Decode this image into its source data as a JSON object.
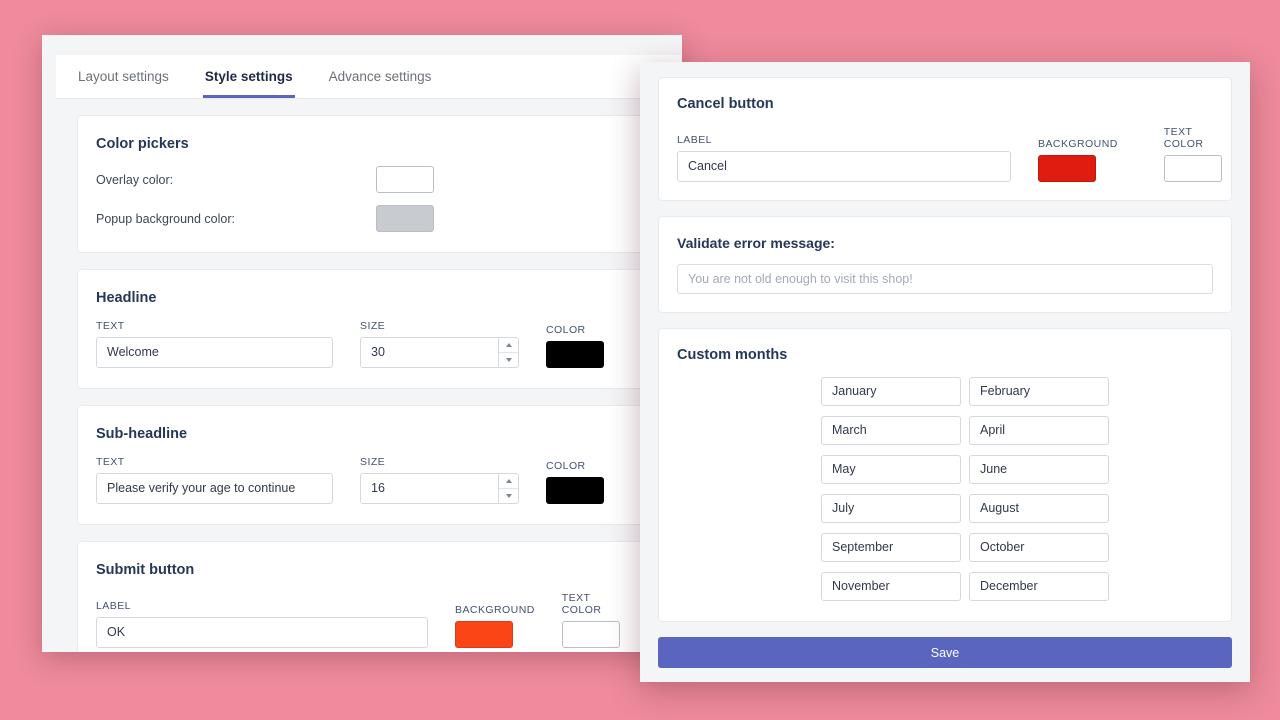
{
  "theme": {
    "page_background": "#ef8b9c",
    "accent": "#5a65c0",
    "panel_background": "#f4f5f7"
  },
  "left_window": {
    "tabs": [
      {
        "label": "Layout settings",
        "active": false
      },
      {
        "label": "Style settings",
        "active": true
      },
      {
        "label": "Advance settings",
        "active": false
      }
    ],
    "color_pickers": {
      "title": "Color pickers",
      "items": [
        {
          "label": "Overlay color:",
          "value": "#ffffff"
        },
        {
          "label": "Popup background color:",
          "value": "#c8cbcf"
        }
      ]
    },
    "headline": {
      "title": "Headline",
      "text_label": "TEXT",
      "text_value": "Welcome",
      "size_label": "SIZE",
      "size_value": "30",
      "color_label": "COLOR",
      "color_value": "#000000"
    },
    "sub_headline": {
      "title": "Sub-headline",
      "text_label": "TEXT",
      "text_value": "Please verify your age to continue",
      "size_label": "SIZE",
      "size_value": "16",
      "color_label": "COLOR",
      "color_value": "#000000"
    },
    "submit_button": {
      "title": "Submit button",
      "label_label": "LABEL",
      "label_value": "OK",
      "background_label": "BACKGROUND",
      "background_value": "#fa4616",
      "text_color_label": "TEXT COLOR",
      "text_color_value": "#ffffff"
    }
  },
  "right_window": {
    "cancel_button": {
      "title": "Cancel button",
      "label_label": "LABEL",
      "label_value": "Cancel",
      "background_label": "BACKGROUND",
      "background_value": "#e01b10",
      "text_color_label": "TEXT COLOR",
      "text_color_value": "#ffffff"
    },
    "validate_error": {
      "title": "Validate error message:",
      "placeholder": "You are not old enough to visit this shop!",
      "value": ""
    },
    "custom_months": {
      "title": "Custom months",
      "months": [
        "January",
        "February",
        "March",
        "April",
        "May",
        "June",
        "July",
        "August",
        "September",
        "October",
        "November",
        "December"
      ]
    },
    "save_label": "Save"
  }
}
